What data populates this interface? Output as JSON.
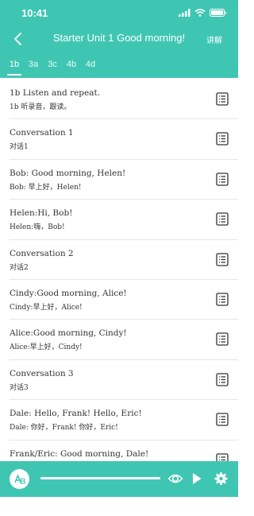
{
  "status_bar": {
    "time": "10:41"
  },
  "nav": {
    "title": "Starter Unit 1 Good morning!",
    "action_label": "讲解"
  },
  "tabs": [
    {
      "label": "1b",
      "active": true
    },
    {
      "label": "3a",
      "active": false
    },
    {
      "label": "3c",
      "active": false
    },
    {
      "label": "4b",
      "active": false
    },
    {
      "label": "4d",
      "active": false
    }
  ],
  "items": [
    {
      "en": "1b Listen and repeat.",
      "zh": "1b 听录音，跟读。"
    },
    {
      "en": "Conversation 1",
      "zh": "对话1"
    },
    {
      "en": "Bob: Good morning, Helen!",
      "zh": "Bob: 早上好，Helen!"
    },
    {
      "en": "Helen:Hi, Bob!",
      "zh": "Helen:嗨，Bob!"
    },
    {
      "en": "Conversation 2",
      "zh": "对话2"
    },
    {
      "en": "Cindy:Good morning, Alice!",
      "zh": "Cindy:早上好，Alice!"
    },
    {
      "en": "Alice:Good morning, Cindy!",
      "zh": "Alice:早上好，Cindy!"
    },
    {
      "en": "Conversation 3",
      "zh": "对话3"
    },
    {
      "en": "Dale: Hello, Frank! Hello, Eric!",
      "zh": "Dale: 你好，Frank! 你好，Eric!"
    },
    {
      "en": "Frank/Eric: Good morning, Dale!",
      "zh": ""
    }
  ],
  "colors": {
    "accent": "#3fc6b3",
    "divider": "#e6e6e6",
    "text": "#333333"
  },
  "icons": {
    "row_action": "list-icon",
    "player": [
      "ab-logo-icon",
      "eye-icon",
      "play-icon",
      "gear-icon"
    ]
  }
}
